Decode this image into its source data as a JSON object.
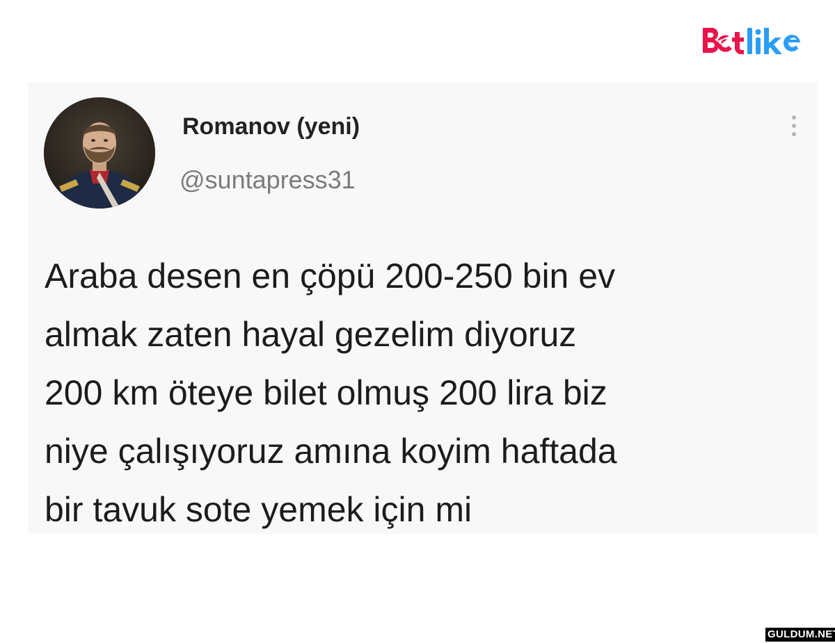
{
  "brand": {
    "logo_text": "Betlike",
    "logo_colors": {
      "b": "#e8144b",
      "et": "#e8144b",
      "like": "#2a9df4"
    }
  },
  "tweet": {
    "author": {
      "display_name": "Romanov (yeni)",
      "handle": "@suntapress31",
      "avatar_icon": "portrait-avatar"
    },
    "more_icon": "vertical-dots-icon",
    "text_lines": [
      "Araba desen en çöpü 200-250 bin ev",
      "almak zaten hayal gezelim diyoruz",
      "200 km öteye bilet olmuş 200 lira biz",
      "niye çalışıyoruz amına koyim haftada",
      "bir tavuk sote yemek için mi"
    ]
  },
  "footer_watermark": "GULDUM.NET"
}
